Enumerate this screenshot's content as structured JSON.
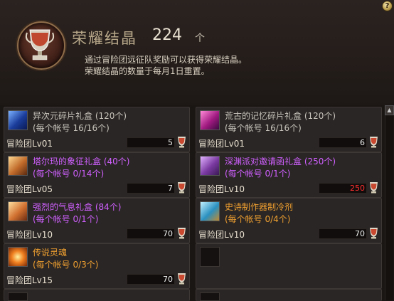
{
  "header": {
    "title": "荣耀结晶",
    "count": "224",
    "unit": "个",
    "desc_line1": "通过冒险团远征队奖励可以获得荣耀结晶。",
    "desc_line2": "荣耀结晶的数量于每月1日重置。",
    "help": "?"
  },
  "colors": {
    "white": "#c8c4bc",
    "purple": "#d060ff",
    "orange": "#f0a030",
    "green": "#5fd04e",
    "price_red": "#ff3030",
    "price_white": "#f0f0f0"
  },
  "items": [
    {
      "name": "异次元碎片礼盒 (120个)",
      "limit": "(每个帐号 16/16个)",
      "level": "冒险团Lv01",
      "price": "5",
      "icon": "blue-crystal-box-icon"
    },
    {
      "name": "荒古的记忆碎片礼盒 (120个)",
      "limit": "(每个帐号 16/16个)",
      "level": "冒险团Lv01",
      "price": "6",
      "icon": "pink-crystal-box-icon"
    },
    {
      "name": "塔尔玛的象征礼盒 (40个)",
      "limit": "(每个帐号 0/14个)",
      "level": "冒险团Lv05",
      "price": "7",
      "icon": "gold-box-icon"
    },
    {
      "name": "深渊派对邀请函礼盒 (250个)",
      "limit": "(每个帐号 0/1个)",
      "level": "冒险团Lv10",
      "price": "250",
      "icon": "purple-box-icon"
    },
    {
      "name": "强烈的气息礼盒 (84个)",
      "limit": "(每个帐号 0/1个)",
      "level": "冒险团Lv10",
      "price": "70",
      "icon": "orange-box-icon"
    },
    {
      "name": "史诗制作器制冷剂",
      "limit": "(每个帐号 0/4个)",
      "level": "冒险团Lv10",
      "price": "70",
      "icon": "cyan-crystal-icon"
    },
    {
      "name": "传说灵魂",
      "limit": "(每个帐号 0/3个)",
      "level": "冒险团Lv15",
      "price": "70",
      "icon": "orange-soul-icon"
    }
  ]
}
